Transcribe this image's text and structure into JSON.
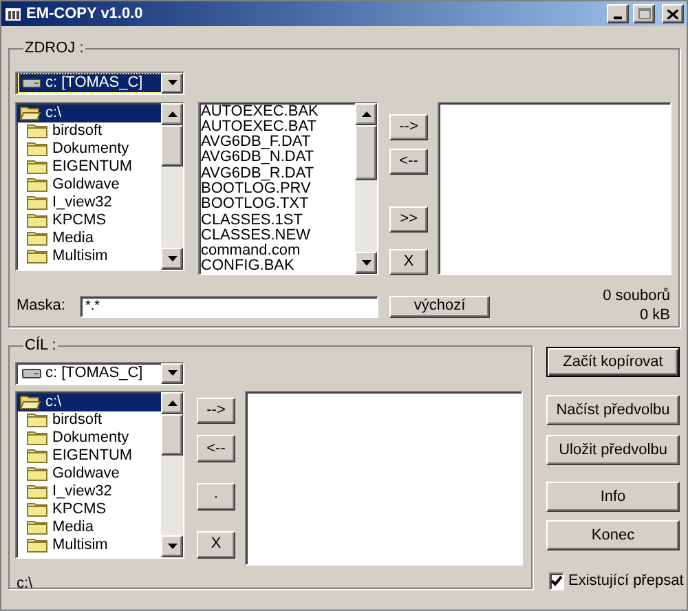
{
  "window": {
    "title": "EM-COPY v1.0.0"
  },
  "source": {
    "label": "ZDROJ :",
    "drive": "c: [TOMAS_C]",
    "focused": true,
    "folders": [
      {
        "name": "c:\\",
        "kind": "open",
        "selected": true
      },
      {
        "name": "birdsoft",
        "kind": "closed",
        "selected": false
      },
      {
        "name": "Dokumenty",
        "kind": "closed",
        "selected": false
      },
      {
        "name": "EIGENTUM",
        "kind": "closed",
        "selected": false
      },
      {
        "name": "Goldwave",
        "kind": "closed",
        "selected": false
      },
      {
        "name": "I_view32",
        "kind": "closed",
        "selected": false
      },
      {
        "name": "KPCMS",
        "kind": "closed",
        "selected": false
      },
      {
        "name": "Media",
        "kind": "closed",
        "selected": false
      },
      {
        "name": "Multisim",
        "kind": "closed",
        "selected": false
      }
    ],
    "files": [
      "AUTOEXEC.BAK",
      "AUTOEXEC.BAT",
      "AVG6DB_F.DAT",
      "AVG6DB_N.DAT",
      "AVG6DB_R.DAT",
      "BOOTLOG.PRV",
      "BOOTLOG.TXT",
      "CLASSES.1ST",
      "CLASSES.NEW",
      "command.com",
      "CONFIG.BAK"
    ],
    "move_buttons": [
      "-->",
      "<--",
      ">>",
      "X"
    ],
    "mask_label": "Maska:",
    "mask_value": "*.*",
    "default_button": "výchozí",
    "file_count": "0 souborů",
    "size": "0 kB"
  },
  "target": {
    "label": "CÍL :",
    "drive": "c: [TOMAS_C]",
    "focused": false,
    "folders": [
      {
        "name": "c:\\",
        "kind": "open",
        "selected": true
      },
      {
        "name": "birdsoft",
        "kind": "closed",
        "selected": false
      },
      {
        "name": "Dokumenty",
        "kind": "closed",
        "selected": false
      },
      {
        "name": "EIGENTUM",
        "kind": "closed",
        "selected": false
      },
      {
        "name": "Goldwave",
        "kind": "closed",
        "selected": false
      },
      {
        "name": "I_view32",
        "kind": "closed",
        "selected": false
      },
      {
        "name": "KPCMS",
        "kind": "closed",
        "selected": false
      },
      {
        "name": "Media",
        "kind": "closed",
        "selected": false
      },
      {
        "name": "Multisim",
        "kind": "closed",
        "selected": false
      }
    ],
    "move_buttons": [
      "-->",
      "<--",
      "·",
      "X"
    ],
    "path": "c:\\"
  },
  "actions": [
    {
      "label": "Začít kopírovat",
      "default": true
    },
    {
      "label": "Načíst předvolbu",
      "default": false
    },
    {
      "label": "Uložit předvolbu",
      "default": false
    },
    {
      "label": "Info",
      "default": false
    },
    {
      "label": "Konec",
      "default": false
    }
  ],
  "overwrite": {
    "label": "Existující přepsat",
    "checked": true
  }
}
